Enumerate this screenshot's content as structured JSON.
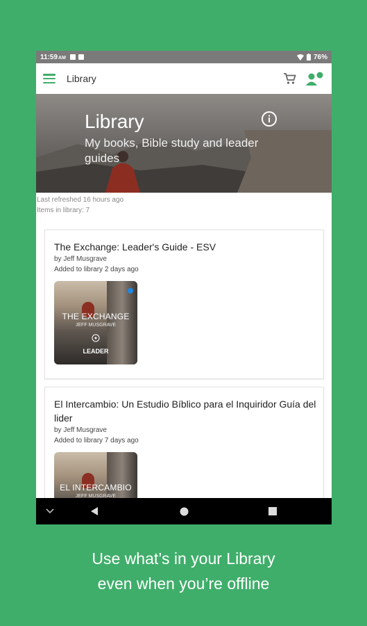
{
  "status_bar": {
    "time": "11:59",
    "ampm": "AM",
    "battery": "76%"
  },
  "app_bar": {
    "title": "Library"
  },
  "hero": {
    "title": "Library",
    "subtitle": "My books, Bible study and leader guides"
  },
  "library_meta": {
    "last_refreshed": "Last refreshed 16 hours ago",
    "items_count": "Items in library: 7"
  },
  "books": [
    {
      "title": "The Exchange: Leader's Guide - ESV",
      "author": "by Jeff Musgrave",
      "added": "Added to library 2 days ago",
      "cover_title": "THE EXCHANGE",
      "cover_author": "JEFF MUSGRAVE",
      "cover_label": "LEADER"
    },
    {
      "title": "El Intercambio: Un Estudio Bíblico para el Inquiridor Guía del lider",
      "author": "by Jeff Musgrave",
      "added": "Added to library 7 days ago",
      "cover_title": "EL INTERCAMBIO",
      "cover_author": "JEFF MUSGRAVE"
    }
  ],
  "tagline": {
    "line1": "Use what’s in your Library",
    "line2": "even when you’re offline"
  },
  "colors": {
    "brand_green": "#3fae6a",
    "unread_dot": "#1e88e5"
  },
  "icons": [
    "menu-icon",
    "cart-icon",
    "account-icon",
    "info-icon",
    "back-icon",
    "home-icon",
    "recents-icon",
    "chevron-down-icon"
  ]
}
